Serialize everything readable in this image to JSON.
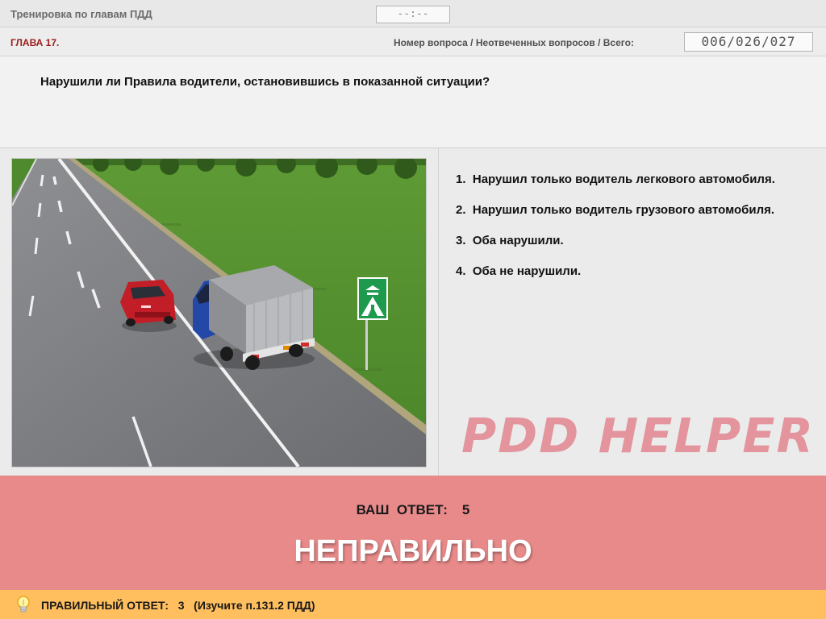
{
  "header": {
    "title": "Тренировка по главам ПДД",
    "timer": "--:--"
  },
  "chapter_bar": {
    "chapter": "ГЛАВА 17.",
    "counter_label": "Номер вопроса / Неотвеченных вопросов / Всего:",
    "counter_value": "006/026/027"
  },
  "question": {
    "text": "Нарушили ли Правила водители, остановившись в показанной ситуации?"
  },
  "answers": [
    {
      "number": "1.",
      "text": "Нарушил только водитель легкового автомобиля."
    },
    {
      "number": "2.",
      "text": "Нарушил только водитель грузового автомобиля."
    },
    {
      "number": "3.",
      "text": "Оба нарушили."
    },
    {
      "number": "4.",
      "text": "Оба не нарушили."
    }
  ],
  "watermark": "PDD HELPER",
  "result": {
    "your_answer_label": "ВАШ  ОТВЕТ:",
    "your_answer_value": "5",
    "verdict": "НЕПРАВИЛЬНО"
  },
  "hint": {
    "text": "ПРАВИЛЬНЫЙ ОТВЕТ:   3   (Изучите п.131.2 ПДД)",
    "icon": "lightbulb-icon"
  },
  "colors": {
    "result_band": "#e98a8a",
    "hint_bar": "#ffbf5e",
    "chapter_text": "#9b1c1c",
    "watermark": "#e2828b"
  }
}
